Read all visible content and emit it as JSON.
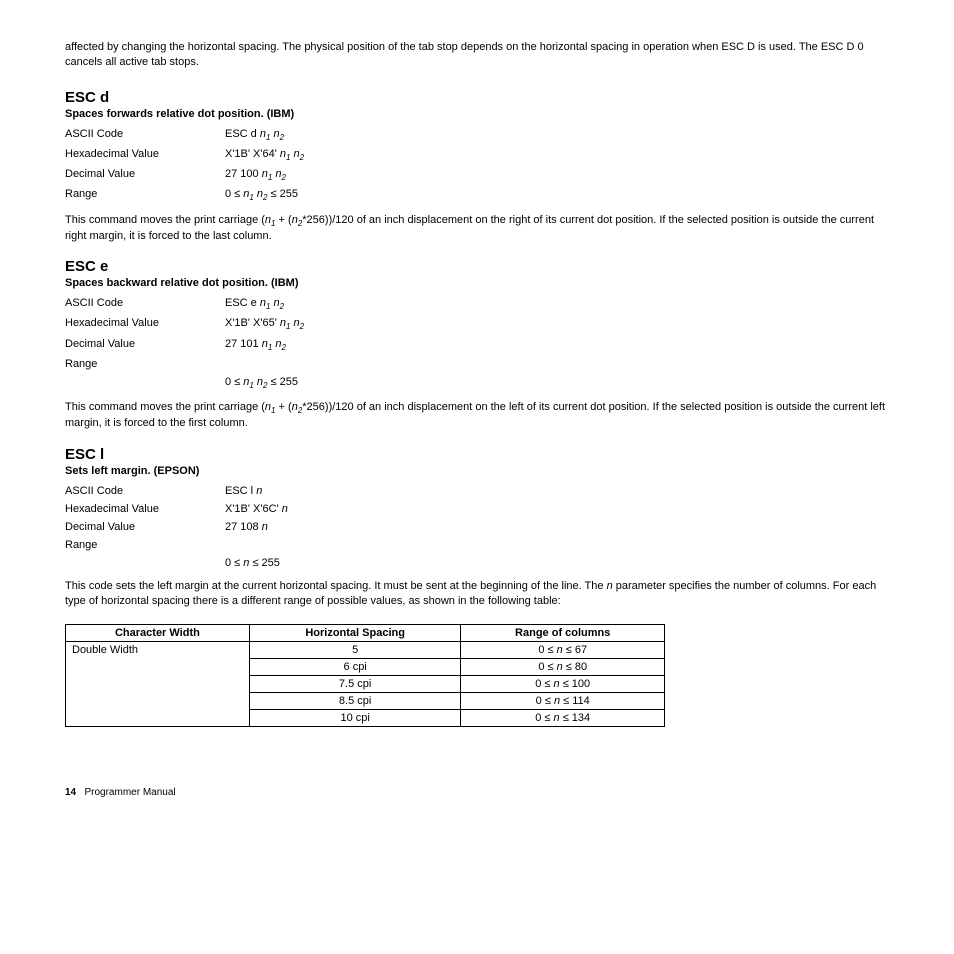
{
  "intro": "affected by changing the horizontal spacing. The physical position of the tab stop depends on the horizontal spacing in operation when ESC D is used. The ESC D 0 cancels all active tab stops.",
  "sections": [
    {
      "title": "ESC d",
      "subtitle": "Spaces forwards relative dot position. (IBM)",
      "rows": [
        {
          "k": "ASCII Code",
          "v_pre": "ESC d ",
          "v_n1n2": true
        },
        {
          "k": "Hexadecimal Value",
          "v_pre": "X'1B' X'64' ",
          "v_n1n2": true
        },
        {
          "k": "Decimal Value",
          "v_pre": "27 100 ",
          "v_n1n2": true
        },
        {
          "k": "Range",
          "v_pre": "0 ≤ ",
          "v_n1": true,
          "v_mid": " ",
          "v_n2": true,
          "v_post": " ≤ 255"
        }
      ],
      "desc_pre": "This command moves the print carriage (",
      "desc_formula": true,
      "desc_post": "*256))/120 of an inch displacement on the right of its current dot position. If the selected position is outside the current right margin, it is forced to the last column."
    },
    {
      "title": "ESC e",
      "subtitle": "Spaces backward relative dot position. (IBM)",
      "rows": [
        {
          "k": "ASCII Code",
          "v_pre": "ESC e ",
          "v_n1n2": true
        },
        {
          "k": "Hexadecimal Value",
          "v_pre": "X'1B' X'65' ",
          "v_n1n2": true
        },
        {
          "k": "Decimal Value",
          "v_pre": "27 101 ",
          "v_n1n2": true
        },
        {
          "k": "Range",
          "v_pre": ""
        },
        {
          "k": "",
          "v_pre": "0 ≤ ",
          "v_n1": true,
          "v_mid": " ",
          "v_n2": true,
          "v_post": " ≤ 255"
        }
      ],
      "desc_pre": "This command moves the print carriage (",
      "desc_formula": true,
      "desc_post": "*256))/120 of an inch displacement on the left of its current dot position. If the selected position is outside the current left margin, it is forced to the first column."
    },
    {
      "title": "ESC l",
      "subtitle": "Sets left margin. (EPSON)",
      "rows": [
        {
          "k": "ASCII Code",
          "v_pre": "ESC l ",
          "v_n": true
        },
        {
          "k": "Hexadecimal Value",
          "v_pre": "X'1B' X'6C' ",
          "v_n": true
        },
        {
          "k": "Decimal Value",
          "v_pre": "27 108 ",
          "v_n": true
        },
        {
          "k": "Range",
          "v_pre": ""
        },
        {
          "k": "",
          "v_pre": "0 ≤ ",
          "v_n": true,
          "v_post": " ≤ 255"
        }
      ],
      "desc_plain_pre": "This code sets the left margin at the current horizontal spacing. It must be sent at the beginning of the line. The ",
      "desc_plain_mid": " parameter specifies the number of columns. For each type of horizontal spacing there is a different range of possible values, as shown in the following table:"
    }
  ],
  "table": {
    "headers": [
      "Character Width",
      "Horizontal Spacing",
      "Range of columns"
    ],
    "rows": [
      {
        "cw": "Double Width",
        "hs": "5",
        "rc_pre": "0 ≤ ",
        "rc_post": " ≤ 67"
      },
      {
        "cw": "",
        "hs": "6 cpi",
        "rc_pre": "0 ≤ ",
        "rc_post": " ≤ 80"
      },
      {
        "cw": "",
        "hs": "7.5 cpi",
        "rc_pre": "0 ≤ ",
        "rc_post": " ≤ 100"
      },
      {
        "cw": "",
        "hs": "8.5 cpi",
        "rc_pre": "0 ≤ ",
        "rc_post": " ≤ 114"
      },
      {
        "cw": "",
        "hs": "10 cpi",
        "rc_pre": "0 ≤ ",
        "rc_post": " ≤ 134"
      }
    ]
  },
  "footer": {
    "page": "14",
    "label": "Programmer Manual"
  },
  "sym": {
    "n": "n",
    "n1": "n",
    "s1": "1",
    "n2": "n",
    "s2": "2"
  }
}
